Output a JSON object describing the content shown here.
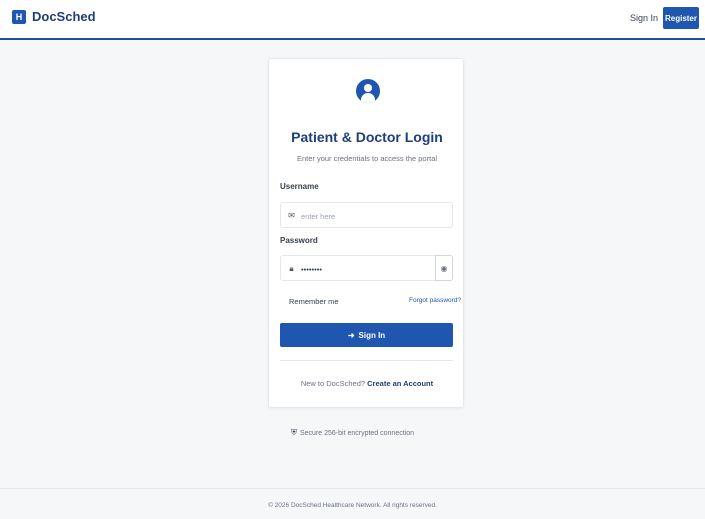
{
  "header": {
    "logo_letter": "H",
    "brand": "DocSched",
    "signin": "Sign In",
    "register": "Register"
  },
  "login": {
    "title": "Patient & Doctor Login",
    "subtitle": "Enter your credentials to access the portal",
    "username_label": "Username",
    "username_placeholder": "enter here",
    "password_label": "Password",
    "password_value": "••••••••",
    "remember_label": "Remember me",
    "forgot_label": "Forgot password?",
    "submit_label": "Sign In",
    "new_prompt": "New to DocSched?",
    "create_label": "Create an Account"
  },
  "security_note": "Secure 256-bit encrypted connection",
  "footer": "© 2026 DocSched Healthcare Network. All rights reserved.",
  "colors": {
    "primary": "#1e56b0",
    "heading": "#1e3f7a",
    "background": "#f6f7f9"
  },
  "icons": {
    "username": "envelope-icon",
    "password": "lock-icon",
    "toggle": "eye-icon",
    "submit": "sign-in-arrow-icon",
    "security": "shield-icon",
    "avatar": "user-avatar-icon"
  }
}
